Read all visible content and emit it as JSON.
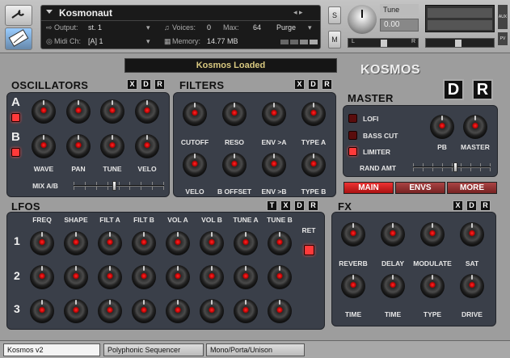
{
  "header": {
    "instrument_name": "Kosmonaut",
    "output_label": "Output:",
    "output_value": "st. 1",
    "midi_label": "Midi Ch:",
    "midi_value": "[A] 1",
    "voices_label": "Voices:",
    "voices_value": "0",
    "max_label": "Max:",
    "max_value": "64",
    "purge_label": "Purge",
    "memory_label": "Memory:",
    "memory_value": "14.77 MB",
    "solo_label": "S",
    "mute_label": "M",
    "tune_label": "Tune",
    "tune_value": "0.00",
    "pan_left": "L",
    "pan_right": "R",
    "aux_label": "AUX",
    "pv_label": "PV"
  },
  "status": "Kosmos Loaded",
  "logo": "KOSMOS",
  "oscillators": {
    "title": "OSCILLATORS",
    "row_a": "A",
    "row_b": "B",
    "labels": [
      "WAVE",
      "PAN",
      "TUNE",
      "VELO"
    ],
    "mix_label": "MIX A/B",
    "mix_value": 0.45
  },
  "filters": {
    "title": "FILTERS",
    "top_labels": [
      "CUTOFF",
      "RESO",
      "ENV >A",
      "TYPE A"
    ],
    "bottom_labels": [
      "VELO",
      "B OFFSET",
      "ENV >B",
      "TYPE B"
    ]
  },
  "master": {
    "title": "MASTER",
    "d_label": "D",
    "r_label": "R",
    "toggles": [
      {
        "label": "LOFI",
        "on": false
      },
      {
        "label": "BASS CUT",
        "on": false
      },
      {
        "label": "LIMITER",
        "on": true
      }
    ],
    "pb_label": "PB",
    "master_label": "MASTER",
    "rand_label": "RAND AMT",
    "rand_value": 0.55
  },
  "page_tabs": [
    "MAIN",
    "ENVS",
    "MORE"
  ],
  "lfos": {
    "title": "LFOS",
    "columns": [
      "FREQ",
      "SHAPE",
      "FILT A",
      "FILT B",
      "VOL  A",
      "VOL  B",
      "TUNE A",
      "TUNE B"
    ],
    "rows": [
      "1",
      "2",
      "3"
    ],
    "ret_label": "RET"
  },
  "fx": {
    "title": "FX",
    "top_labels": [
      "REVERB",
      "DELAY",
      "MODULATE",
      "SAT"
    ],
    "bottom_labels": [
      "TIME",
      "TIME",
      "TYPE",
      "DRIVE"
    ]
  },
  "xdr": {
    "t": "T",
    "x": "X",
    "d": "D",
    "r": "R"
  },
  "bottom_tabs": [
    "Kosmos v2",
    "Polyphonic Sequencer",
    "Mono/Porta/Unison"
  ],
  "colors": {
    "accent": "#cc2222",
    "panel": "#3a3f49"
  }
}
